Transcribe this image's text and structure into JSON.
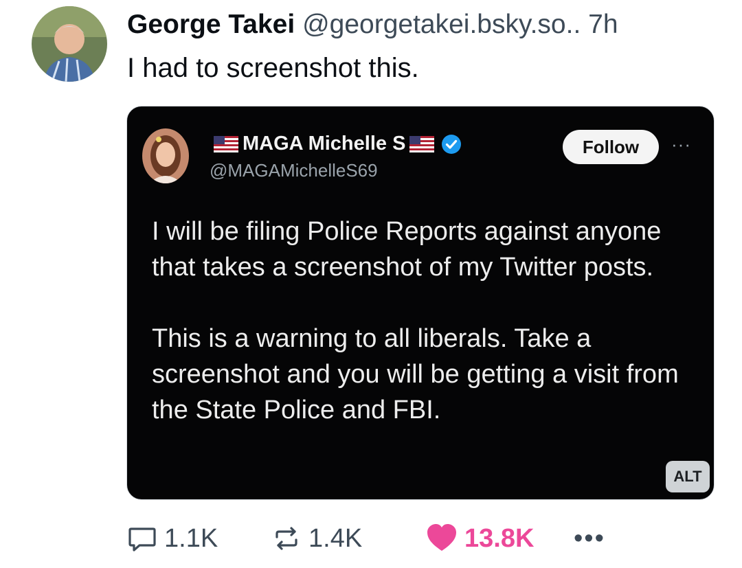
{
  "post": {
    "author_name": "George Takei",
    "handle": "@georgetakei.bsky.so..",
    "time": "7h",
    "text": "I had to screenshot this."
  },
  "embed": {
    "name": "MAGA Michelle S",
    "handle": "@MAGAMichelleS69",
    "follow_label": "Follow",
    "more_label": "···",
    "paragraphs": [
      "I will be filing Police Reports against anyone that takes a screenshot of my Twitter posts.",
      "This is a warning to all liberals. Take a screenshot and you will be getting a visit from the State Police and FBI."
    ],
    "alt_label": "ALT"
  },
  "actions": {
    "replies": "1.1K",
    "reposts": "1.4K",
    "likes": "13.8K",
    "more_label": "•••"
  },
  "colors": {
    "like": "#ec4899",
    "verified": "#1d9bf0",
    "embed_bg": "#050506"
  }
}
